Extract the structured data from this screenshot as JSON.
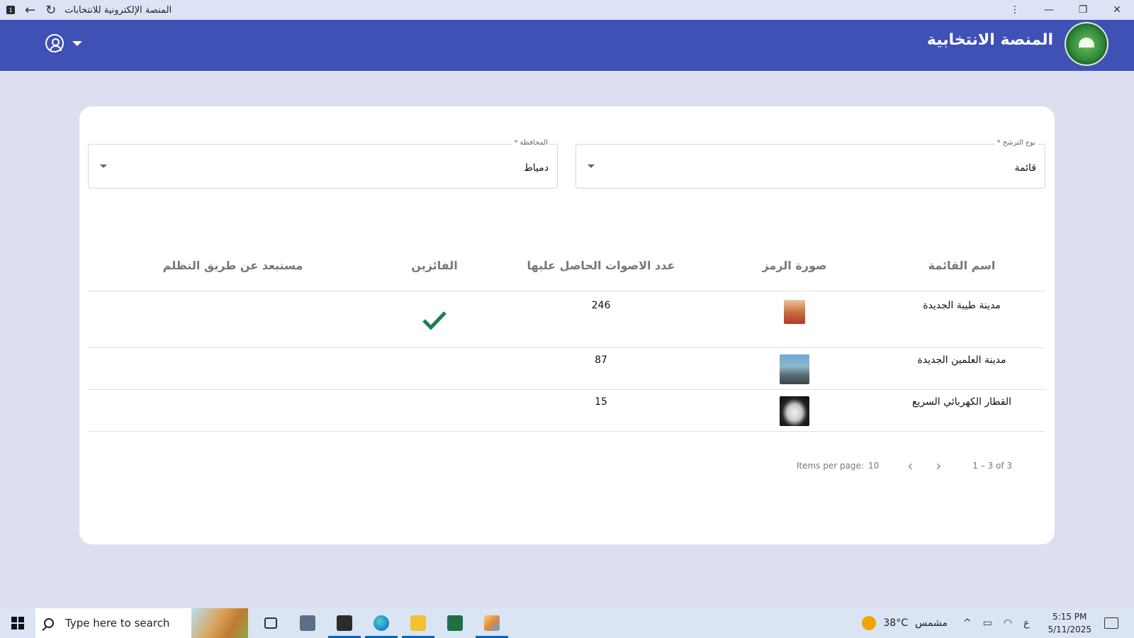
{
  "window": {
    "title": "المنصة الإلكترونية للانتخابات",
    "app_badge": "1",
    "back_glyph": "←",
    "reload_glyph": "↻",
    "more_glyph": "⋮",
    "minimize_glyph": "—",
    "restore_glyph": "❐",
    "close_glyph": "✕"
  },
  "header": {
    "brand": "المنصة الانتخابية",
    "color": "#3f51b5"
  },
  "filters": {
    "type": {
      "label": "نوع الترشح *",
      "value": "قائمة"
    },
    "governorate": {
      "label": "المحافظة *",
      "value": "دمياط"
    }
  },
  "table": {
    "headers": [
      "اسم القائمة",
      "صورة الرمز",
      "عدد الاصوات الحاصل عليها",
      "الفائزين",
      "مستبعد عن طريق التظلم"
    ],
    "rows": [
      {
        "name": "مدينة طيبة الجديدة",
        "symbol": "taiba-symbol",
        "votes": "246",
        "winner": true,
        "excluded": ""
      },
      {
        "name": "مدينة العلمين الجديدة",
        "symbol": "alamein-city-symbol",
        "votes": "87",
        "winner": false,
        "excluded": ""
      },
      {
        "name": "القطار الكهربائي السريع",
        "symbol": "high-speed-train-symbol",
        "votes": "15",
        "winner": false,
        "excluded": ""
      }
    ],
    "winner_color": "#1e7d4f"
  },
  "paginator": {
    "items_per_page_label": "Items per page:",
    "items_per_page": "10",
    "prev_glyph": "‹",
    "next_glyph": "›",
    "range": "1 – 3 of 3"
  },
  "taskbar": {
    "search_placeholder": "Type here to search",
    "weather_temp": "38°C",
    "weather_text": "مشمس",
    "chevron_glyph": "^",
    "lang": "ع",
    "time": "5:15 PM",
    "date": "5/11/2025"
  }
}
